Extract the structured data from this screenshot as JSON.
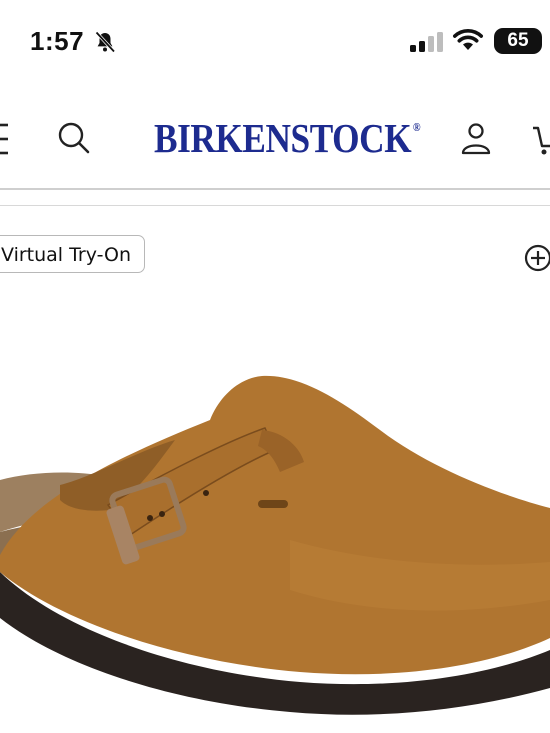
{
  "status_bar": {
    "time": "1:57",
    "battery": "65",
    "icons": [
      "bell-muted-icon",
      "cellular-signal-icon",
      "wifi-icon",
      "battery-icon"
    ]
  },
  "header": {
    "logo_text": "BIRKENSTOCK",
    "logo_mark": "®",
    "logo_color": "#1d2b8f",
    "icons": [
      "menu-icon",
      "search-icon",
      "account-icon",
      "cart-icon"
    ]
  },
  "product": {
    "virtual_try_on_label": "Virtual Try-On",
    "zoom_icon": "plus-circle-icon",
    "image_subject": "clog-shoe",
    "colors": {
      "suede": "#b07530",
      "sole": "#2a2320",
      "cork": "#9d8060",
      "buckle": "#9a7a5a"
    }
  }
}
